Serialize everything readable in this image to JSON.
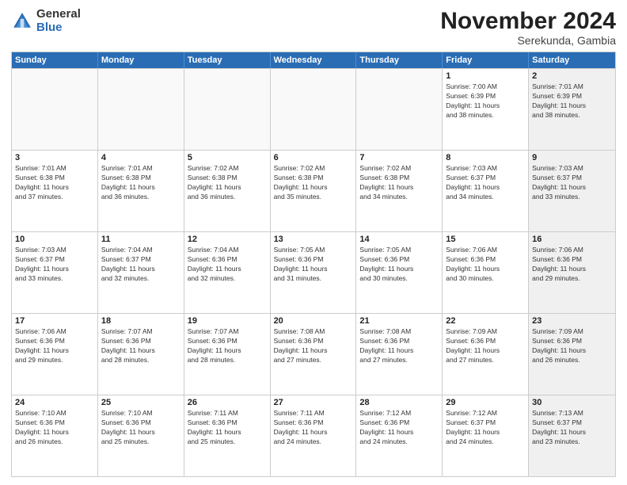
{
  "logo": {
    "general": "General",
    "blue": "Blue"
  },
  "title": "November 2024",
  "subtitle": "Serekunda, Gambia",
  "days_of_week": [
    "Sunday",
    "Monday",
    "Tuesday",
    "Wednesday",
    "Thursday",
    "Friday",
    "Saturday"
  ],
  "weeks": [
    [
      {
        "day": "",
        "empty": true
      },
      {
        "day": "",
        "empty": true
      },
      {
        "day": "",
        "empty": true
      },
      {
        "day": "",
        "empty": true
      },
      {
        "day": "",
        "empty": true
      },
      {
        "day": "1",
        "info": "Sunrise: 7:00 AM\nSunset: 6:39 PM\nDaylight: 11 hours\nand 38 minutes."
      },
      {
        "day": "2",
        "info": "Sunrise: 7:01 AM\nSunset: 6:39 PM\nDaylight: 11 hours\nand 38 minutes.",
        "shaded": true
      }
    ],
    [
      {
        "day": "3",
        "info": "Sunrise: 7:01 AM\nSunset: 6:38 PM\nDaylight: 11 hours\nand 37 minutes."
      },
      {
        "day": "4",
        "info": "Sunrise: 7:01 AM\nSunset: 6:38 PM\nDaylight: 11 hours\nand 36 minutes."
      },
      {
        "day": "5",
        "info": "Sunrise: 7:02 AM\nSunset: 6:38 PM\nDaylight: 11 hours\nand 36 minutes."
      },
      {
        "day": "6",
        "info": "Sunrise: 7:02 AM\nSunset: 6:38 PM\nDaylight: 11 hours\nand 35 minutes."
      },
      {
        "day": "7",
        "info": "Sunrise: 7:02 AM\nSunset: 6:38 PM\nDaylight: 11 hours\nand 34 minutes."
      },
      {
        "day": "8",
        "info": "Sunrise: 7:03 AM\nSunset: 6:37 PM\nDaylight: 11 hours\nand 34 minutes."
      },
      {
        "day": "9",
        "info": "Sunrise: 7:03 AM\nSunset: 6:37 PM\nDaylight: 11 hours\nand 33 minutes.",
        "shaded": true
      }
    ],
    [
      {
        "day": "10",
        "info": "Sunrise: 7:03 AM\nSunset: 6:37 PM\nDaylight: 11 hours\nand 33 minutes."
      },
      {
        "day": "11",
        "info": "Sunrise: 7:04 AM\nSunset: 6:37 PM\nDaylight: 11 hours\nand 32 minutes."
      },
      {
        "day": "12",
        "info": "Sunrise: 7:04 AM\nSunset: 6:36 PM\nDaylight: 11 hours\nand 32 minutes."
      },
      {
        "day": "13",
        "info": "Sunrise: 7:05 AM\nSunset: 6:36 PM\nDaylight: 11 hours\nand 31 minutes."
      },
      {
        "day": "14",
        "info": "Sunrise: 7:05 AM\nSunset: 6:36 PM\nDaylight: 11 hours\nand 30 minutes."
      },
      {
        "day": "15",
        "info": "Sunrise: 7:06 AM\nSunset: 6:36 PM\nDaylight: 11 hours\nand 30 minutes."
      },
      {
        "day": "16",
        "info": "Sunrise: 7:06 AM\nSunset: 6:36 PM\nDaylight: 11 hours\nand 29 minutes.",
        "shaded": true
      }
    ],
    [
      {
        "day": "17",
        "info": "Sunrise: 7:06 AM\nSunset: 6:36 PM\nDaylight: 11 hours\nand 29 minutes."
      },
      {
        "day": "18",
        "info": "Sunrise: 7:07 AM\nSunset: 6:36 PM\nDaylight: 11 hours\nand 28 minutes."
      },
      {
        "day": "19",
        "info": "Sunrise: 7:07 AM\nSunset: 6:36 PM\nDaylight: 11 hours\nand 28 minutes."
      },
      {
        "day": "20",
        "info": "Sunrise: 7:08 AM\nSunset: 6:36 PM\nDaylight: 11 hours\nand 27 minutes."
      },
      {
        "day": "21",
        "info": "Sunrise: 7:08 AM\nSunset: 6:36 PM\nDaylight: 11 hours\nand 27 minutes."
      },
      {
        "day": "22",
        "info": "Sunrise: 7:09 AM\nSunset: 6:36 PM\nDaylight: 11 hours\nand 27 minutes."
      },
      {
        "day": "23",
        "info": "Sunrise: 7:09 AM\nSunset: 6:36 PM\nDaylight: 11 hours\nand 26 minutes.",
        "shaded": true
      }
    ],
    [
      {
        "day": "24",
        "info": "Sunrise: 7:10 AM\nSunset: 6:36 PM\nDaylight: 11 hours\nand 26 minutes."
      },
      {
        "day": "25",
        "info": "Sunrise: 7:10 AM\nSunset: 6:36 PM\nDaylight: 11 hours\nand 25 minutes."
      },
      {
        "day": "26",
        "info": "Sunrise: 7:11 AM\nSunset: 6:36 PM\nDaylight: 11 hours\nand 25 minutes."
      },
      {
        "day": "27",
        "info": "Sunrise: 7:11 AM\nSunset: 6:36 PM\nDaylight: 11 hours\nand 24 minutes."
      },
      {
        "day": "28",
        "info": "Sunrise: 7:12 AM\nSunset: 6:36 PM\nDaylight: 11 hours\nand 24 minutes."
      },
      {
        "day": "29",
        "info": "Sunrise: 7:12 AM\nSunset: 6:37 PM\nDaylight: 11 hours\nand 24 minutes."
      },
      {
        "day": "30",
        "info": "Sunrise: 7:13 AM\nSunset: 6:37 PM\nDaylight: 11 hours\nand 23 minutes.",
        "shaded": true
      }
    ]
  ]
}
